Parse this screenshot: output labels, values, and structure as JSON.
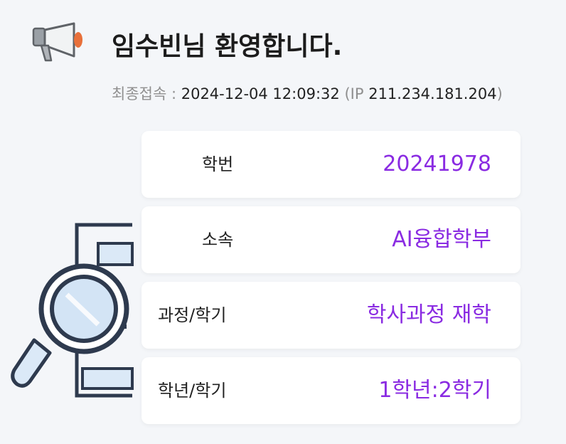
{
  "header": {
    "welcome_text": "임수빈님 환영합니다.",
    "last_login_label": "최종접속 :",
    "last_login_time": "2024-12-04 12:09:32",
    "ip_open": "(IP",
    "ip_address": "211.234.181.204",
    "ip_close": ")"
  },
  "info": {
    "rows": [
      {
        "label": "학번",
        "value": "20241978"
      },
      {
        "label": "소속",
        "value": "AI융합학부"
      },
      {
        "label": "과정/학기",
        "value": "학사과정 재학"
      },
      {
        "label": "학년/학기",
        "value": "1학년:2학기"
      }
    ]
  },
  "icons": {
    "announcement": "megaphone-icon",
    "illustration": "magnifier-document-illustration"
  },
  "colors": {
    "value_accent": "#8a2be2",
    "background": "#f4f6f9",
    "card": "#ffffff"
  }
}
